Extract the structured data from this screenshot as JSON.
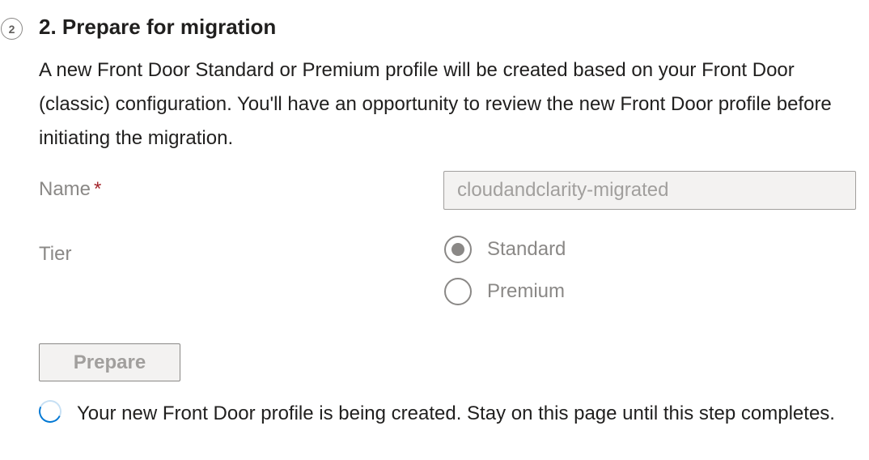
{
  "step": {
    "number": "2",
    "title": "2. Prepare for migration",
    "description": "A new Front Door Standard or Premium profile will be created based on your Front Door (classic) configuration. You'll have an opportunity to review the new Front Door profile before initiating the migration."
  },
  "form": {
    "name_label": "Name",
    "name_required": "*",
    "name_value": "cloudandclarity-migrated",
    "tier_label": "Tier",
    "tier_options": [
      {
        "label": "Standard",
        "selected": true
      },
      {
        "label": "Premium",
        "selected": false
      }
    ]
  },
  "actions": {
    "prepare_label": "Prepare"
  },
  "status": {
    "message": "Your new Front Door profile is being created. Stay on this page until this step completes."
  },
  "colors": {
    "text_primary": "#201f1e",
    "text_disabled": "#8a8886",
    "required": "#a4262c",
    "spinner_accent": "#0078d4"
  },
  "icons": {
    "step_badge": "step-number-icon",
    "progress": "spinner-icon"
  }
}
